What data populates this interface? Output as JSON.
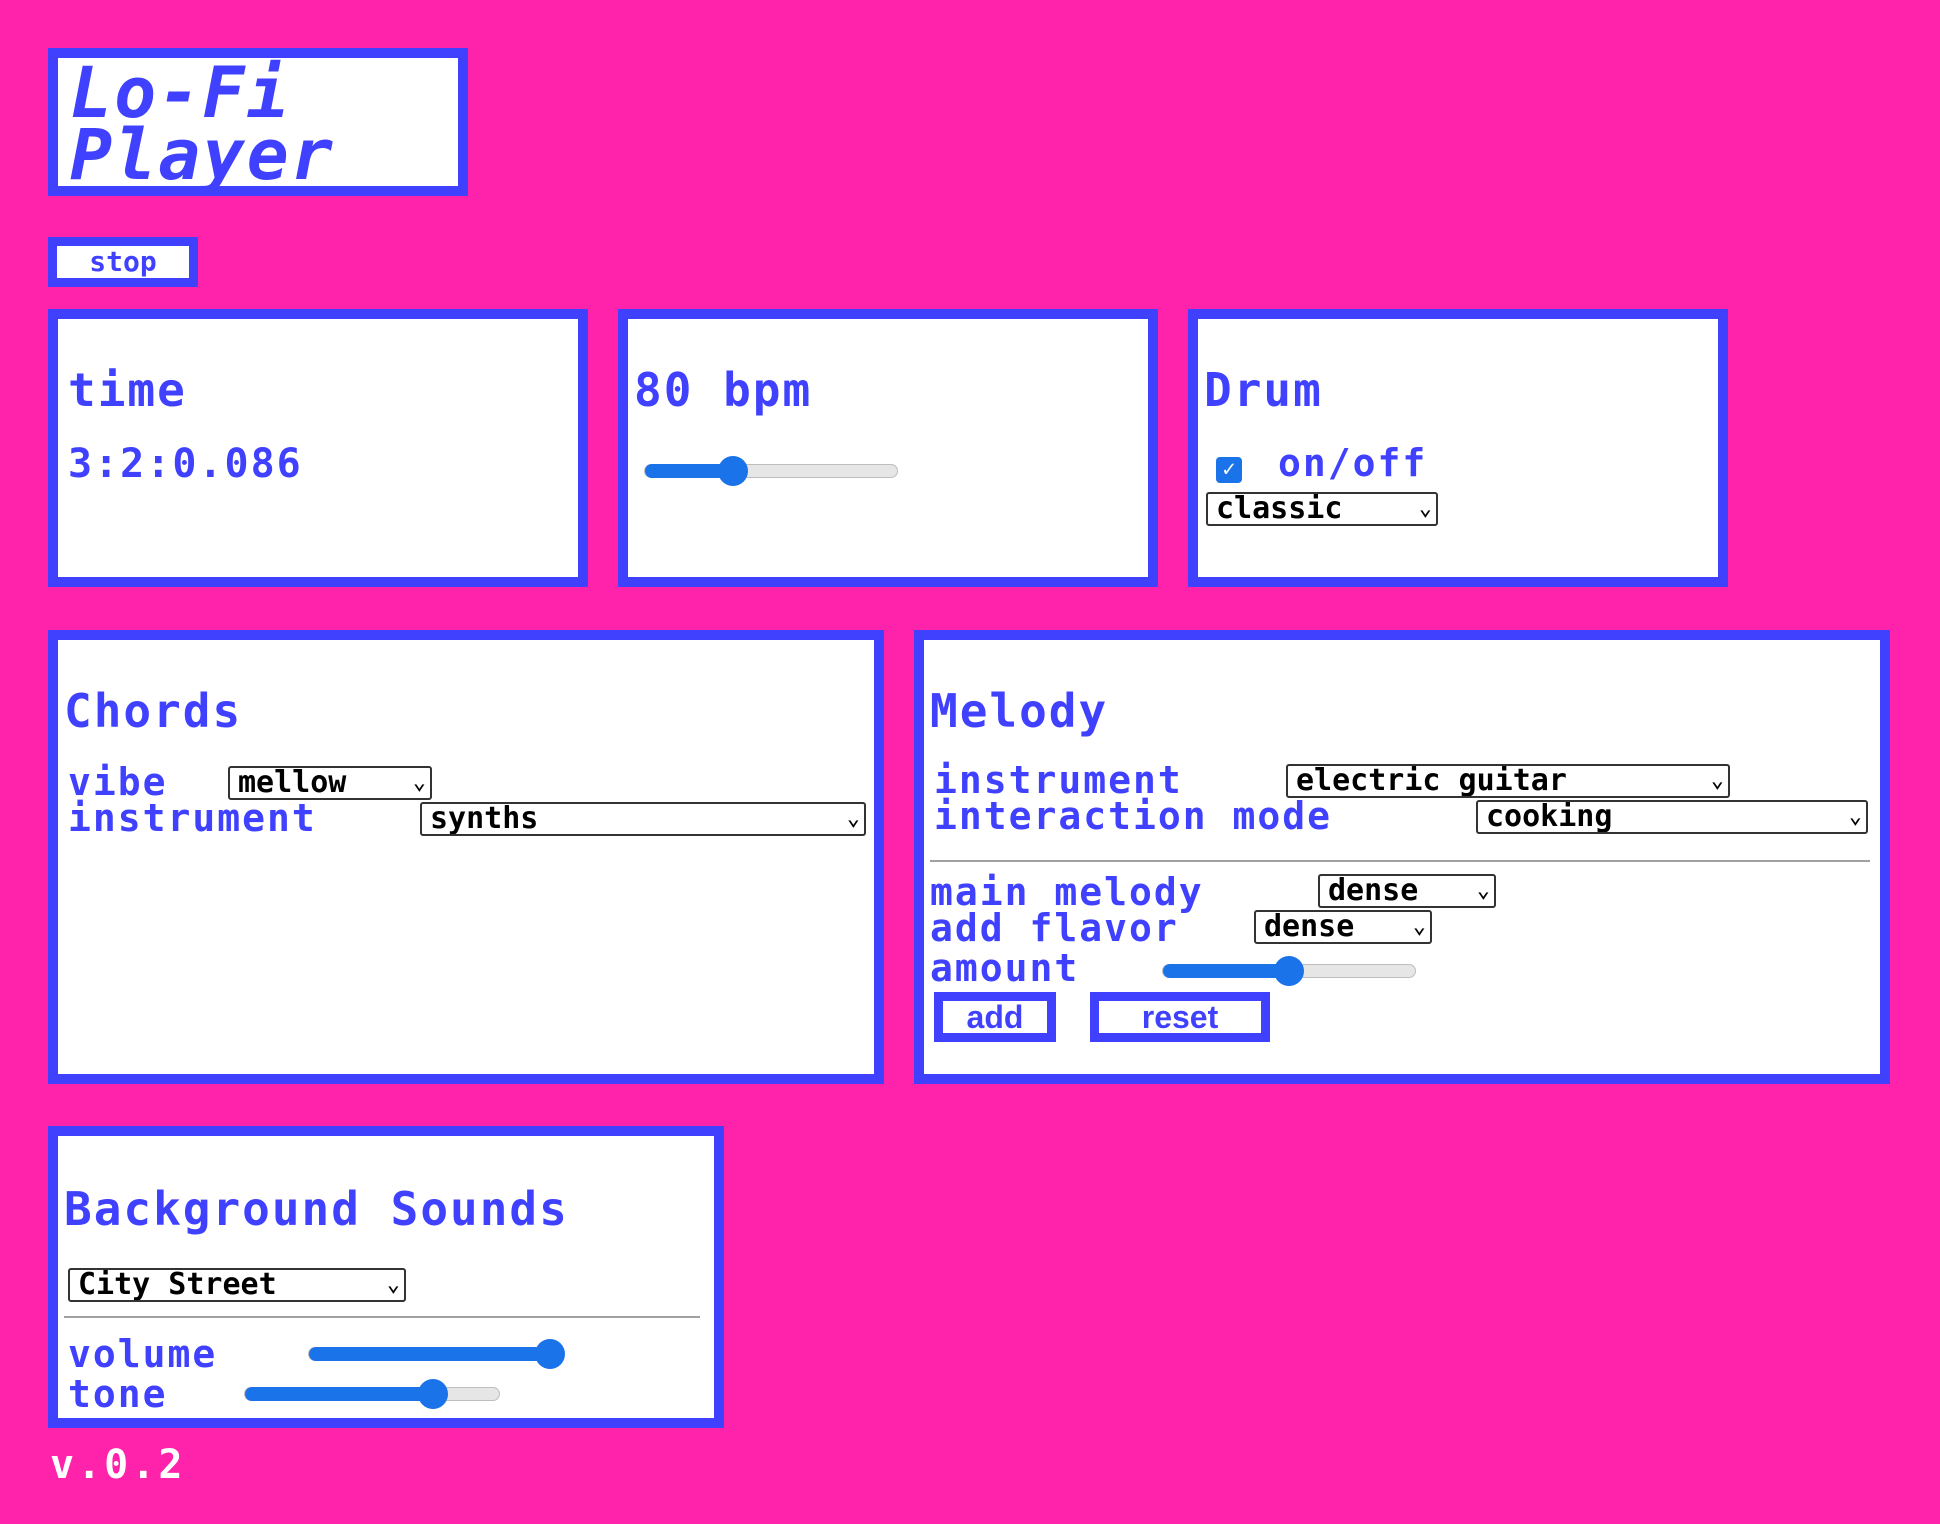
{
  "app": {
    "title_line1": "Lo-Fi",
    "title_line2": "Player",
    "stop_label": "stop",
    "version": "v.0.2"
  },
  "time": {
    "title": "time",
    "value": "3:2:0.086"
  },
  "bpm": {
    "title": "80 bpm",
    "slider_fraction": 0.35
  },
  "drum": {
    "title": "Drum",
    "toggle_label": "on/off",
    "enabled": true,
    "style_selected": "classic"
  },
  "chords": {
    "title": "Chords",
    "vibe_label": "vibe",
    "vibe_selected": "mellow",
    "instrument_label": "instrument",
    "instrument_selected": "synths"
  },
  "melody": {
    "title": "Melody",
    "instrument_label": "instrument",
    "instrument_selected": "electric guitar",
    "interaction_label": "interaction mode",
    "interaction_selected": "cooking",
    "main_melody_label": "main melody",
    "main_melody_selected": "dense",
    "flavor_label": "add flavor",
    "flavor_selected": "dense",
    "amount_label": "amount",
    "amount_fraction": 0.5,
    "add_label": "add",
    "reset_label": "reset"
  },
  "background": {
    "title": "Background Sounds",
    "sound_selected": "City Street",
    "volume_label": "volume",
    "volume_fraction": 0.95,
    "tone_label": "tone",
    "tone_fraction": 0.74
  },
  "colors": {
    "background": "#ff22aa",
    "accent": "#4040ff",
    "slider": "#1a73e8"
  }
}
